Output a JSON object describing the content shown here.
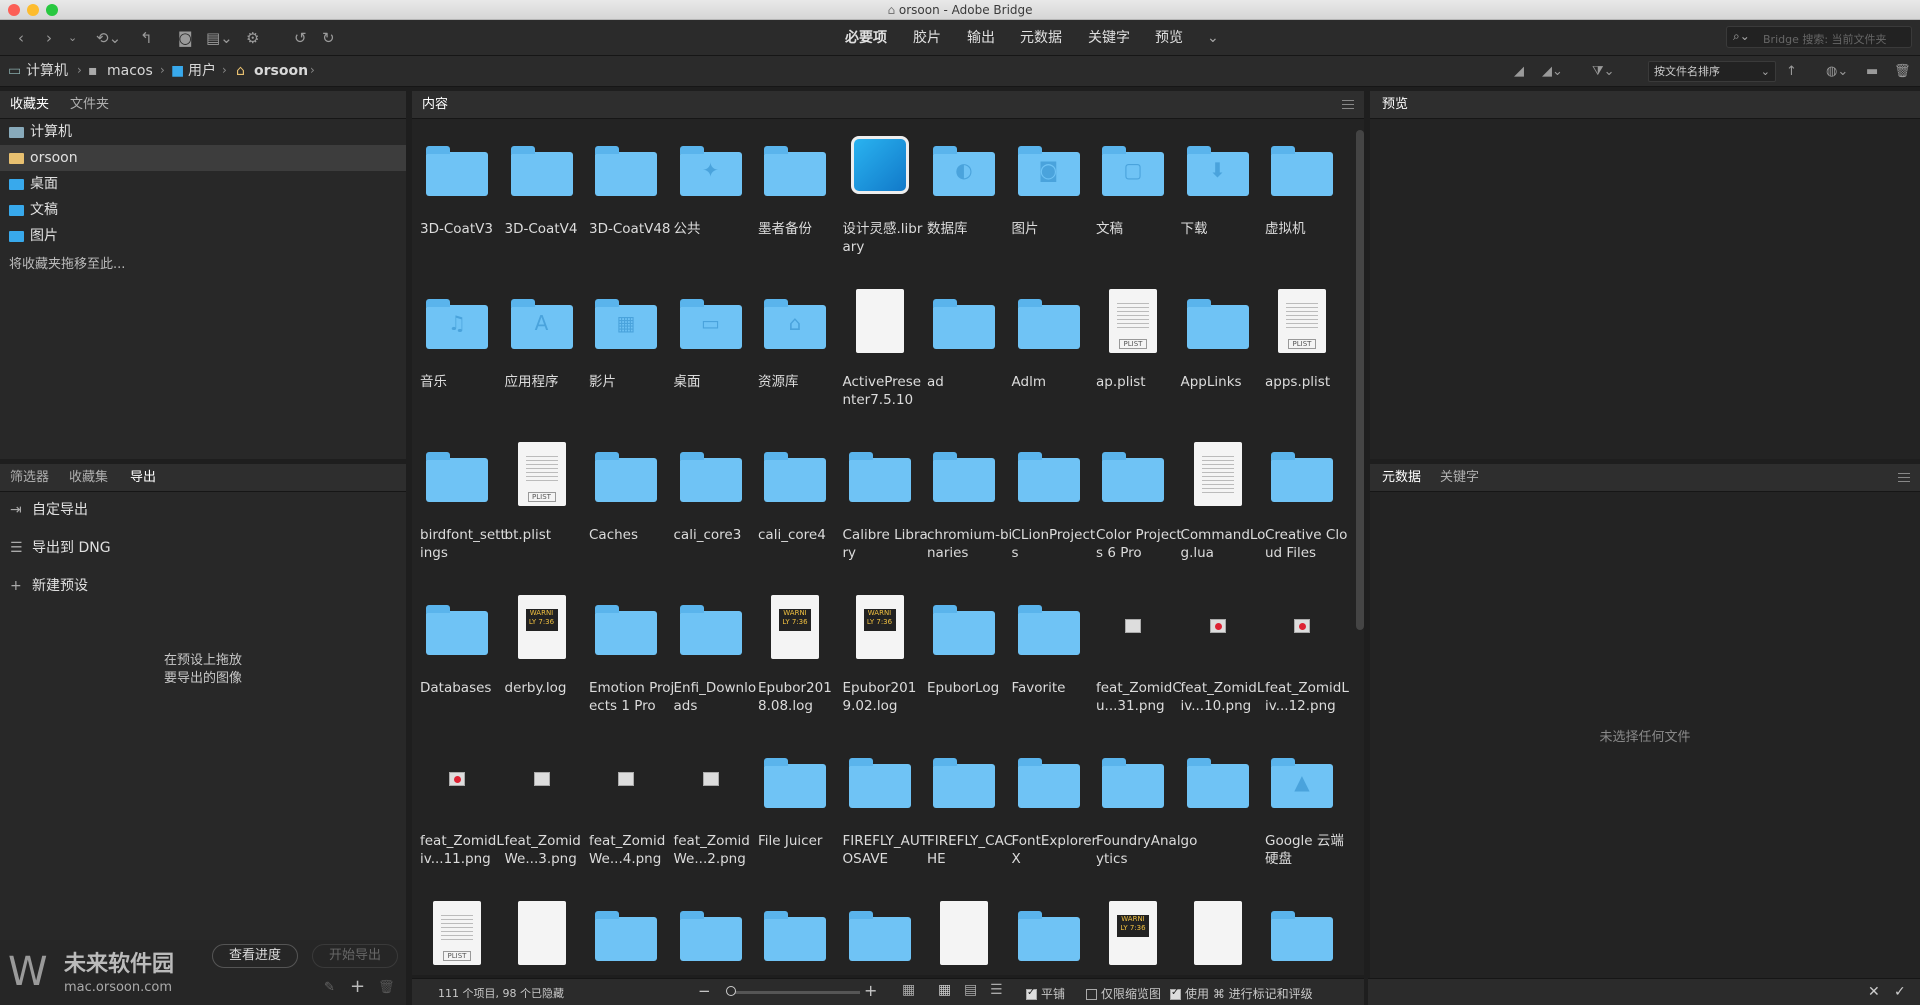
{
  "window": {
    "title": "orsoon - Adobe Bridge"
  },
  "workspaces": [
    "必要项",
    "胶片",
    "输出",
    "元数据",
    "关键字",
    "预览"
  ],
  "search": {
    "placeholder": "Bridge 搜索: 当前文件夹"
  },
  "breadcrumb": [
    "计算机",
    "macos",
    "用户",
    "orsoon"
  ],
  "sort": {
    "label": "按文件名排序"
  },
  "left_top": {
    "tabs": [
      "收藏夹",
      "文件夹"
    ],
    "items": [
      "计算机",
      "orsoon",
      "桌面",
      "文稿",
      "图片"
    ],
    "hint": "将收藏夹拖移至此..."
  },
  "left_bottom": {
    "tabs": [
      "筛选器",
      "收藏集",
      "导出"
    ],
    "items": [
      "自定导出",
      "导出到 DNG",
      "新建预设"
    ],
    "drop_hint_1": "在预设上拖放",
    "drop_hint_2": "要导出的图像",
    "progress_btn": "查看进度",
    "start_btn": "开始导出"
  },
  "content": {
    "title": "内容"
  },
  "files": [
    {
      "name": "3D-CoatV3",
      "kind": "folder"
    },
    {
      "name": "3D-CoatV4",
      "kind": "folder"
    },
    {
      "name": "3D-CoatV48",
      "kind": "folder"
    },
    {
      "name": "公共",
      "kind": "folder",
      "emblem": "✦"
    },
    {
      "name": "墨者备份",
      "kind": "folder"
    },
    {
      "name": "设计灵感.library",
      "kind": "app"
    },
    {
      "name": "数据库",
      "kind": "folder",
      "emblem": "◐"
    },
    {
      "name": "图片",
      "kind": "folder",
      "emblem": "◙"
    },
    {
      "name": "文稿",
      "kind": "folder",
      "emblem": "▢"
    },
    {
      "name": "下载",
      "kind": "folder",
      "emblem": "⬇"
    },
    {
      "name": "虚拟机",
      "kind": "folder"
    },
    {
      "name": "音乐",
      "kind": "folder",
      "emblem": "♫"
    },
    {
      "name": "应用程序",
      "kind": "folder",
      "emblem": "A"
    },
    {
      "name": "影片",
      "kind": "folder",
      "emblem": "▦"
    },
    {
      "name": "桌面",
      "kind": "folder",
      "emblem": "▭"
    },
    {
      "name": "资源库",
      "kind": "folder",
      "emblem": "⌂"
    },
    {
      "name": "ActivePresenter7.5.10",
      "kind": "blank"
    },
    {
      "name": "ad",
      "kind": "folder"
    },
    {
      "name": "Adlm",
      "kind": "folder"
    },
    {
      "name": "ap.plist",
      "kind": "plist"
    },
    {
      "name": "AppLinks",
      "kind": "folder"
    },
    {
      "name": "apps.plist",
      "kind": "plist"
    },
    {
      "name": "birdfont_settings",
      "kind": "folder"
    },
    {
      "name": "bt.plist",
      "kind": "plist"
    },
    {
      "name": "Caches",
      "kind": "folder"
    },
    {
      "name": "cali_core3",
      "kind": "folder"
    },
    {
      "name": "cali_core4",
      "kind": "folder"
    },
    {
      "name": "Calibre Library",
      "kind": "folder"
    },
    {
      "name": "chromium-binaries",
      "kind": "folder"
    },
    {
      "name": "CLionProjects",
      "kind": "folder"
    },
    {
      "name": "Color Projects 6 Pro",
      "kind": "folder"
    },
    {
      "name": "CommandLog.lua",
      "kind": "text"
    },
    {
      "name": "Creative Cloud Files",
      "kind": "folder"
    },
    {
      "name": "Databases",
      "kind": "folder"
    },
    {
      "name": "derby.log",
      "kind": "log"
    },
    {
      "name": "Emotion Projects 1 Pro",
      "kind": "folder"
    },
    {
      "name": "Enfi_Downloads",
      "kind": "folder"
    },
    {
      "name": "Epubor2018.08.log",
      "kind": "log"
    },
    {
      "name": "Epubor2019.02.log",
      "kind": "log"
    },
    {
      "name": "EpuborLog",
      "kind": "folder"
    },
    {
      "name": "Favorite",
      "kind": "folder"
    },
    {
      "name": "feat_ZomidCu...31.png",
      "kind": "image"
    },
    {
      "name": "feat_ZomidLiv...10.png",
      "kind": "image-red"
    },
    {
      "name": "feat_ZomidLiv...12.png",
      "kind": "image-red"
    },
    {
      "name": "feat_ZomidLiv...11.png",
      "kind": "image-red"
    },
    {
      "name": "feat_ZomidWe...3.png",
      "kind": "image"
    },
    {
      "name": "feat_ZomidWe...4.png",
      "kind": "image"
    },
    {
      "name": "feat_ZomidWe...2.png",
      "kind": "image"
    },
    {
      "name": "File Juicer",
      "kind": "folder"
    },
    {
      "name": "FIREFLY_AUTOSAVE",
      "kind": "folder"
    },
    {
      "name": "FIREFLY_CACHE",
      "kind": "folder"
    },
    {
      "name": "FontExplorer X",
      "kind": "folder"
    },
    {
      "name": "FoundryAnalytics",
      "kind": "folder"
    },
    {
      "name": "go",
      "kind": "folder"
    },
    {
      "name": "Google 云端硬盘",
      "kind": "folder",
      "emblem": "▲"
    },
    {
      "name": "",
      "kind": "plist"
    },
    {
      "name": "",
      "kind": "blank"
    },
    {
      "name": "",
      "kind": "folder"
    },
    {
      "name": "",
      "kind": "folder"
    },
    {
      "name": "",
      "kind": "folder"
    },
    {
      "name": "",
      "kind": "folder"
    },
    {
      "name": "",
      "kind": "blank"
    },
    {
      "name": "",
      "kind": "folder"
    },
    {
      "name": "",
      "kind": "log"
    },
    {
      "name": "",
      "kind": "blank"
    },
    {
      "name": "",
      "kind": "folder"
    }
  ],
  "status": {
    "count": "111 个项目, 98 个已隐藏",
    "tile": "平铺",
    "thumbs_only": "仅限缩览图",
    "use_label": "使用 ⌘ 进行标记和评级"
  },
  "preview": {
    "title": "预览"
  },
  "metadata": {
    "tabs": [
      "元数据",
      "关键字"
    ],
    "empty": "未选择任何文件"
  },
  "watermark": {
    "line1": "未来软件园",
    "line2": "mac.orsoon.com"
  },
  "labels": {
    "plist": "PLIST",
    "warn": "WARNI\nLY 7:36"
  }
}
